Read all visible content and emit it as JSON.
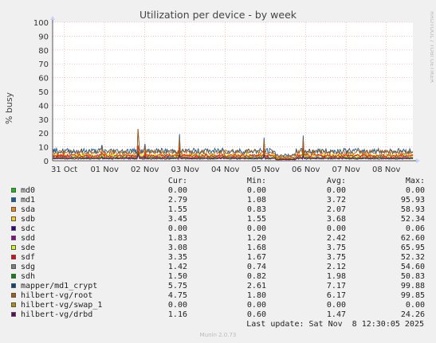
{
  "chart_data": {
    "type": "line",
    "title": "Utilization per device - by week",
    "ylabel": "% busy",
    "ylim": [
      0,
      100
    ],
    "yticks": [
      0,
      10,
      20,
      30,
      40,
      50,
      60,
      70,
      80,
      90,
      100
    ],
    "xticks": [
      "31 Oct",
      "01 Nov",
      "02 Nov",
      "03 Nov",
      "04 Nov",
      "05 Nov",
      "06 Nov",
      "07 Nov",
      "08 Nov"
    ],
    "grid": true,
    "series": [
      {
        "name": "md0",
        "color": "#00cc00",
        "cur": "0.00",
        "min": "0.00",
        "avg": "0.00",
        "max": "0.00",
        "level": 0
      },
      {
        "name": "md1",
        "color": "#0066b3",
        "cur": "2.79",
        "min": "1.08",
        "avg": "3.72",
        "max": "95.93",
        "level": 3.7
      },
      {
        "name": "sda",
        "color": "#ff8000",
        "cur": "1.55",
        "min": "0.83",
        "avg": "2.07",
        "max": "58.93",
        "level": 2.1
      },
      {
        "name": "sdb",
        "color": "#ffcc00",
        "cur": "3.45",
        "min": "1.55",
        "avg": "3.68",
        "max": "52.34",
        "level": 3.7
      },
      {
        "name": "sdc",
        "color": "#330099",
        "cur": "0.00",
        "min": "0.00",
        "avg": "0.00",
        "max": "0.06",
        "level": 0
      },
      {
        "name": "sdd",
        "color": "#990099",
        "cur": "1.83",
        "min": "1.20",
        "avg": "2.42",
        "max": "62.60",
        "level": 2.4
      },
      {
        "name": "sde",
        "color": "#ccff00",
        "cur": "3.08",
        "min": "1.68",
        "avg": "3.75",
        "max": "65.95",
        "level": 3.75
      },
      {
        "name": "sdf",
        "color": "#ff0000",
        "cur": "3.35",
        "min": "1.67",
        "avg": "3.75",
        "max": "52.32",
        "level": 3.75
      },
      {
        "name": "sdg",
        "color": "#808080",
        "cur": "1.42",
        "min": "0.74",
        "avg": "2.12",
        "max": "54.60",
        "level": 2.1
      },
      {
        "name": "sdh",
        "color": "#008f00",
        "cur": "1.50",
        "min": "0.82",
        "avg": "1.98",
        "max": "50.83",
        "level": 2.0
      },
      {
        "name": "mapper/md1_crypt",
        "color": "#00487d",
        "cur": "5.75",
        "min": "2.61",
        "avg": "7.17",
        "max": "99.88",
        "level": 7.2
      },
      {
        "name": "hilbert-vg/root",
        "color": "#b35a00",
        "cur": "4.75",
        "min": "1.80",
        "avg": "6.17",
        "max": "99.85",
        "level": 6.2
      },
      {
        "name": "hilbert-vg/swap_1",
        "color": "#b38f00",
        "cur": "0.00",
        "min": "0.00",
        "avg": "0.00",
        "max": "0.00",
        "level": 0
      },
      {
        "name": "hilbert-vg/drbd",
        "color": "#6b006b",
        "cur": "1.16",
        "min": "0.60",
        "avg": "1.47",
        "max": "24.26",
        "level": 1.5
      }
    ]
  },
  "legend_headers": {
    "cur": "Cur:",
    "min": "Min:",
    "avg": "Avg:",
    "max": "Max:"
  },
  "footer": {
    "last_update": "Last update: Sat Nov  8 12:30:05 2025",
    "munin": "Munin 2.0.73"
  },
  "side_credit": "RRDTOOL / TOBI OETIKER"
}
